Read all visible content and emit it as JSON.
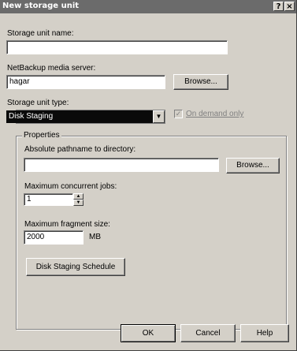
{
  "window": {
    "title": "New storage unit",
    "help_label": "?",
    "close_label": "×"
  },
  "form": {
    "storage_unit_name_label": "Storage unit name:",
    "storage_unit_name_value": "",
    "media_server_label": "NetBackup media server:",
    "media_server_value": "hagar",
    "media_server_browse": "Browse...",
    "unit_type_label": "Storage unit type:",
    "unit_type_value": "Disk Staging",
    "on_demand_label": "On demand only",
    "on_demand_checked": true
  },
  "properties": {
    "group_label": "Properties",
    "path_label": "Absolute pathname to directory:",
    "path_value": "",
    "path_browse": "Browse...",
    "concurrent_jobs_label": "Maximum concurrent jobs:",
    "concurrent_jobs_value": "1",
    "fragment_size_label": "Maximum fragment size:",
    "fragment_size_value": "2000",
    "fragment_size_unit": "MB",
    "schedule_button": "Disk Staging Schedule"
  },
  "footer": {
    "ok": "OK",
    "cancel": "Cancel",
    "help": "Help"
  },
  "colors": {
    "dialog_bg": "#d4d0c8",
    "titlebar_bg": "#6b6b6b",
    "selected_bg": "#0a0a0a"
  }
}
